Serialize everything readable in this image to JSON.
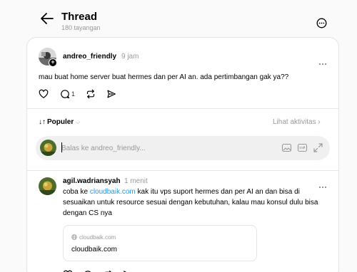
{
  "header": {
    "title": "Thread",
    "views": "180 tayangan"
  },
  "post": {
    "author": "andreo_friendly",
    "time": "9 jam",
    "text": "mau buat home server buat hermes dan per AI an. ada pertimbangan gak ya??",
    "reply_count": "1"
  },
  "sort": {
    "label": "Populer",
    "activity_label": "Lihat aktivitas"
  },
  "reply_box": {
    "placeholder": "Balas ke andreo_friendly..."
  },
  "comment": {
    "author": "agil.wadriansyah",
    "time": "1 menit",
    "text_before": "coba ke ",
    "link": "cloudbaik.com",
    "text_after": " kak itu vps suport hermes dan per AI an dan bisa di sesuaikan untuk resource sesuai dengan kebutuhan, kalau mau konsul dulu bisa dengan CS nya",
    "preview_domain": "cloudbaik.com",
    "preview_title": "cloudbaik.com"
  }
}
